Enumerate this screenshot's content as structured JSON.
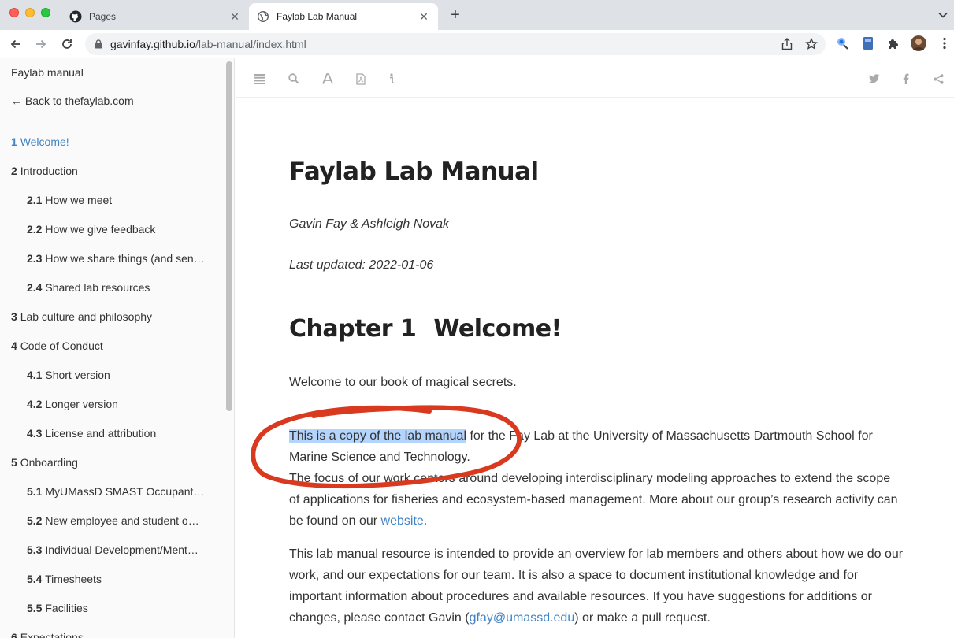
{
  "browser": {
    "tabs": [
      {
        "title": "Pages",
        "icon": "github-icon",
        "active": false
      },
      {
        "title": "Faylab Lab Manual",
        "icon": "globe-icon",
        "active": true
      }
    ],
    "url_host": "gavinfay.github.io",
    "url_path": "/lab-manual/index.html"
  },
  "sidebar": {
    "title": "Faylab manual",
    "back_link": "← Back to thefaylab.com",
    "items": [
      {
        "num": "1",
        "label": "Welcome!",
        "level": 1,
        "active": true
      },
      {
        "num": "2",
        "label": "Introduction",
        "level": 1
      },
      {
        "num": "2.1",
        "label": "How we meet",
        "level": 2
      },
      {
        "num": "2.2",
        "label": "How we give feedback",
        "level": 2
      },
      {
        "num": "2.3",
        "label": "How we share things (and sen…",
        "level": 2
      },
      {
        "num": "2.4",
        "label": "Shared lab resources",
        "level": 2
      },
      {
        "num": "3",
        "label": "Lab culture and philosophy",
        "level": 1
      },
      {
        "num": "4",
        "label": "Code of Conduct",
        "level": 1
      },
      {
        "num": "4.1",
        "label": "Short version",
        "level": 2
      },
      {
        "num": "4.2",
        "label": "Longer version",
        "level": 2
      },
      {
        "num": "4.3",
        "label": "License and attribution",
        "level": 2
      },
      {
        "num": "5",
        "label": "Onboarding",
        "level": 1
      },
      {
        "num": "5.1",
        "label": "MyUMassD SMAST Occupant…",
        "level": 2
      },
      {
        "num": "5.2",
        "label": "New employee and student o…",
        "level": 2
      },
      {
        "num": "5.3",
        "label": "Individual Development/Ment…",
        "level": 2
      },
      {
        "num": "5.4",
        "label": "Timesheets",
        "level": 2
      },
      {
        "num": "5.5",
        "label": "Facilities",
        "level": 2
      },
      {
        "num": "6",
        "label": "Expectations",
        "level": 1
      }
    ]
  },
  "book": {
    "title": "Faylab Lab Manual",
    "author": "Gavin Fay & Ashleigh Novak",
    "date": "Last updated: 2022-01-06",
    "chapter_num": "Chapter 1",
    "chapter_title": "Welcome!",
    "p1": "Welcome to our book of magical secrets.",
    "p2_highlight": "This is a copy of the lab manual",
    "p2_rest": " for the Fay Lab at the University of Massachusetts Dartmouth School for Marine Science and Technology.",
    "p2b": "The focus of our work centers around developing interdisciplinary modeling approaches to extend the scope of applications for fisheries and ecosystem-based management. More about our group’s research activity can be found on our ",
    "p2b_link": "website",
    "p2b_end": ".",
    "p3_start": "This lab manual resource is intended to provide an overview for lab members and others about how we do our work, and our expectations for our team. It is also a space to document institutional knowledge and for important information about procedures and available resources. If you have suggestions for additions or changes, please contact Gavin (",
    "p3_link": "gfay@umassd.edu",
    "p3_end": ") or make a pull request."
  },
  "colors": {
    "link": "#4183c4",
    "highlight": "#b3d4fd",
    "annotation": "#d93a1f"
  }
}
